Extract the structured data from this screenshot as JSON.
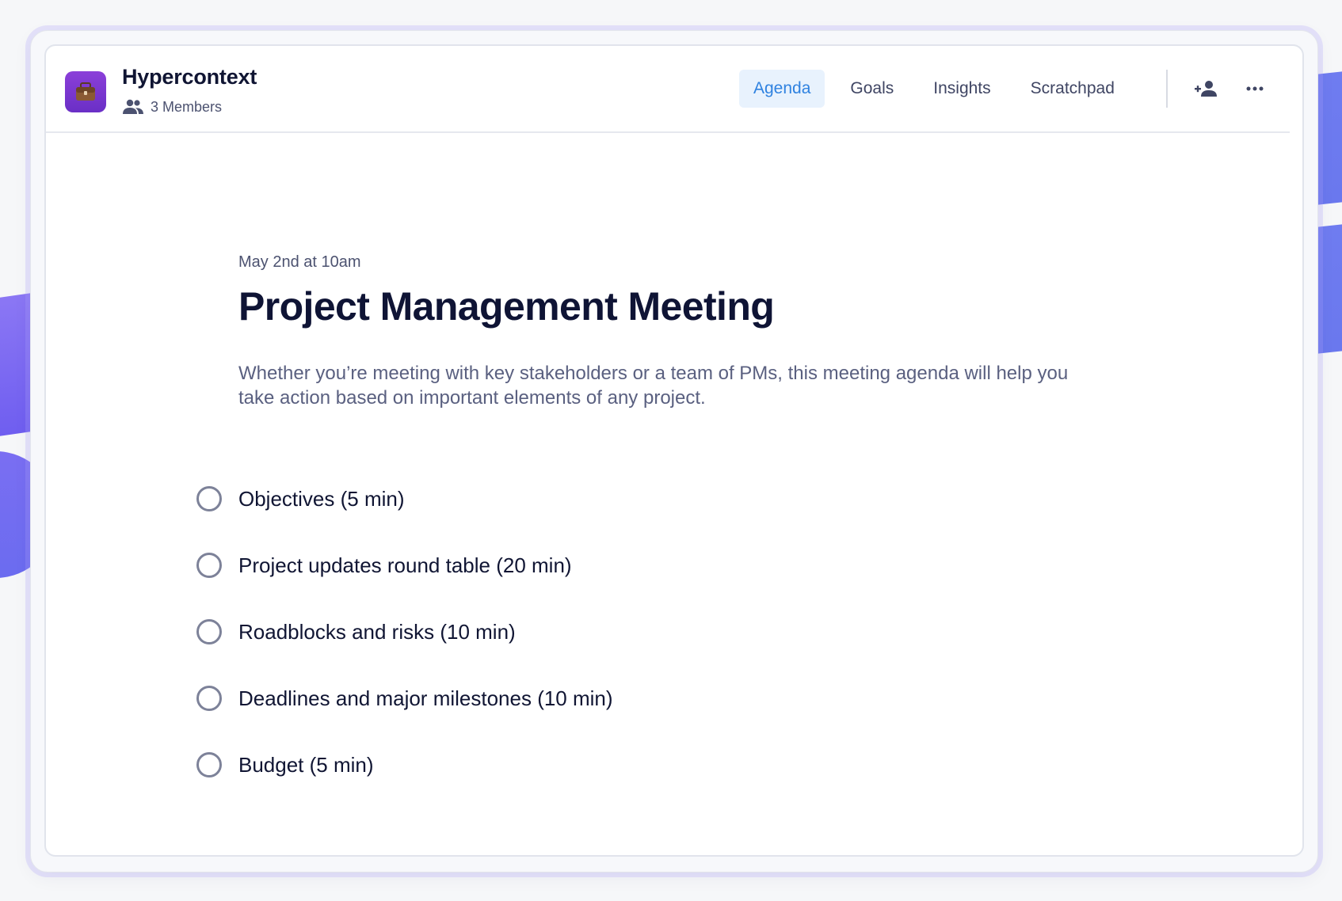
{
  "app": {
    "title": "Hypercontext",
    "members_label": "3 Members",
    "icon": "briefcase-icon",
    "accent_color": "#7b3fd6"
  },
  "nav": {
    "tabs": [
      {
        "label": "Agenda",
        "active": true
      },
      {
        "label": "Goals",
        "active": false
      },
      {
        "label": "Insights",
        "active": false
      },
      {
        "label": "Scratchpad",
        "active": false
      }
    ],
    "active_color": "#2f82e0",
    "actions": [
      {
        "icon": "add-person-icon"
      },
      {
        "icon": "more-horizontal-icon"
      }
    ]
  },
  "meeting": {
    "date": "May 2nd at 10am",
    "title": "Project Management Meeting",
    "description": "Whether you’re meeting with key stakeholders or a team of PMs, this meeting agenda will help you take action based on important elements of any project.",
    "agenda_items": [
      {
        "label": "Objectives (5 min)",
        "checked": false
      },
      {
        "label": "Project updates round table (20 min)",
        "checked": false
      },
      {
        "label": "Roadblocks and risks (10 min)",
        "checked": false
      },
      {
        "label": "Deadlines and major milestones (10 min)",
        "checked": false
      },
      {
        "label": "Budget (5 min)",
        "checked": false
      }
    ]
  }
}
